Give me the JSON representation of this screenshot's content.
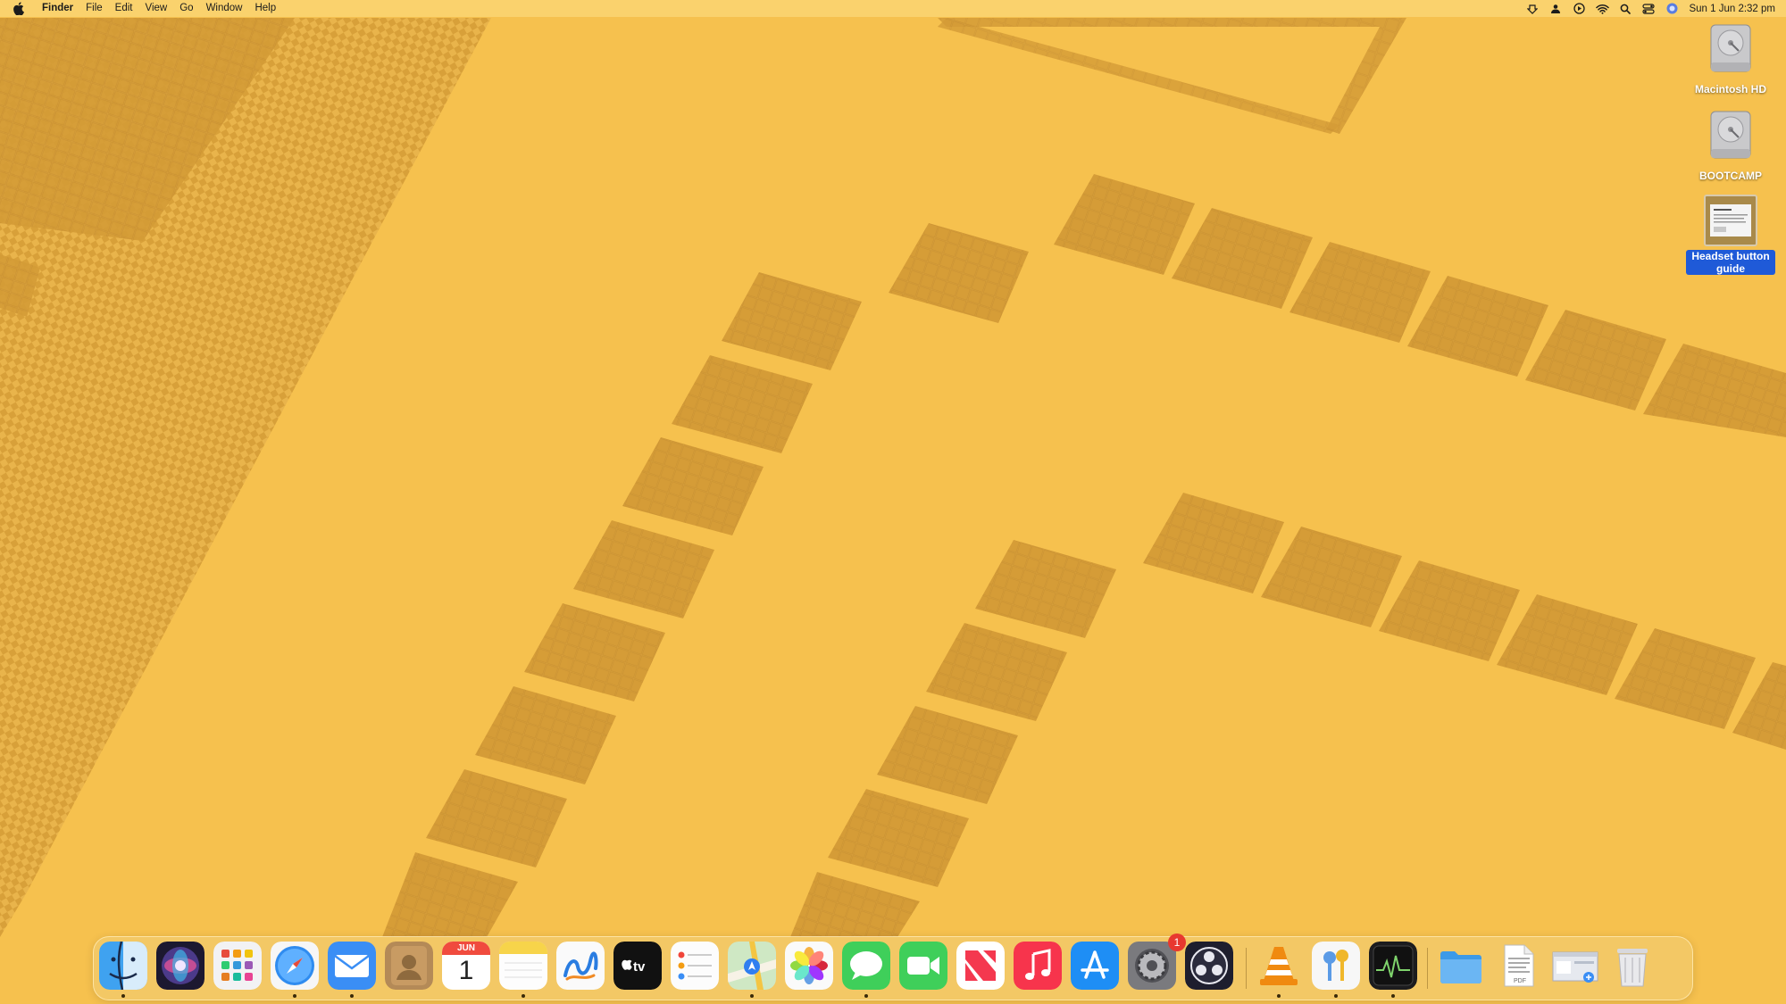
{
  "menubar": {
    "app_name": "Finder",
    "menus": [
      "File",
      "Edit",
      "View",
      "Go",
      "Window",
      "Help"
    ],
    "status_icons": [
      "backup-icon",
      "user-icon",
      "play-circle-icon",
      "wifi-icon",
      "search-icon",
      "control-center-icon",
      "siri-icon"
    ],
    "clock": "Sun 1 Jun  2:32 pm"
  },
  "desktop": {
    "icons": [
      {
        "label": "Macintosh HD",
        "icon": "hard-drive-icon",
        "selected": false
      },
      {
        "label": "BOOTCAMP",
        "icon": "hard-drive-icon",
        "selected": false
      },
      {
        "label": "Headset button guide",
        "icon": "document-thumbnail-icon",
        "selected": true
      }
    ]
  },
  "dock": {
    "apps": [
      {
        "name": "Finder",
        "icon": "finder-icon",
        "running": true
      },
      {
        "name": "Siri",
        "icon": "siri-icon",
        "running": false
      },
      {
        "name": "Launchpad",
        "icon": "launchpad-icon",
        "running": false
      },
      {
        "name": "Safari",
        "icon": "safari-icon",
        "running": true
      },
      {
        "name": "Mail",
        "icon": "mail-icon",
        "running": true
      },
      {
        "name": "Contacts",
        "icon": "contacts-icon",
        "running": false
      },
      {
        "name": "Calendar",
        "icon": "calendar-icon",
        "running": false,
        "month": "JUN",
        "day": "1"
      },
      {
        "name": "Notes",
        "icon": "notes-icon",
        "running": true
      },
      {
        "name": "Freeform",
        "icon": "freeform-icon",
        "running": false
      },
      {
        "name": "TV",
        "icon": "apple-tv-icon",
        "running": false
      },
      {
        "name": "Reminders",
        "icon": "reminders-icon",
        "running": false
      },
      {
        "name": "Maps",
        "icon": "maps-icon",
        "running": true
      },
      {
        "name": "Photos",
        "icon": "photos-icon",
        "running": false
      },
      {
        "name": "Messages",
        "icon": "messages-icon",
        "running": true
      },
      {
        "name": "FaceTime",
        "icon": "facetime-icon",
        "running": false
      },
      {
        "name": "News",
        "icon": "news-icon",
        "running": false
      },
      {
        "name": "Music",
        "icon": "music-icon",
        "running": false
      },
      {
        "name": "App Store",
        "icon": "app-store-icon",
        "running": false
      },
      {
        "name": "System Settings",
        "icon": "system-settings-icon",
        "running": false,
        "badge": "1"
      },
      {
        "name": "OBS",
        "icon": "obs-icon",
        "running": false
      },
      {
        "name": "VLC",
        "icon": "vlc-icon",
        "running": true
      },
      {
        "name": "Keychain Access",
        "icon": "keychain-icon",
        "running": true
      },
      {
        "name": "Activity Monitor",
        "icon": "activity-monitor-icon",
        "running": true
      }
    ],
    "stacks": [
      {
        "name": "Downloads",
        "icon": "folder-icon"
      },
      {
        "name": "Document",
        "icon": "pdf-document-icon"
      },
      {
        "name": "Screenshot",
        "icon": "screenshot-icon"
      },
      {
        "name": "Trash",
        "icon": "trash-icon"
      }
    ]
  },
  "colors": {
    "wallpaper": "#F6C14E",
    "grid_pattern": "#D9A23A",
    "selection": "#1F5AD8",
    "badge": "#E8382F"
  }
}
